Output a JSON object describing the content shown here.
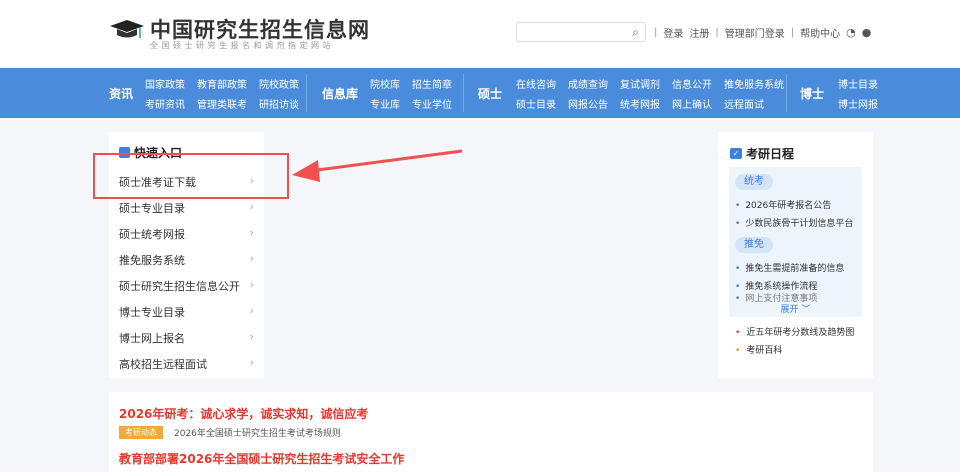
{
  "header": {
    "title": "中国研究生招生信息网",
    "subtitle": "全国硕士研究生报名和调剂指定网站",
    "search_placeholder": "",
    "links": [
      "登录",
      "注册",
      "管理部门登录",
      "帮助中心"
    ]
  },
  "nav": [
    {
      "head": "资讯",
      "items": [
        "国家政策",
        "考研资讯",
        "教育部政策",
        "管理类联考",
        "院校政策",
        "研招访谈"
      ]
    },
    {
      "head": "信息库",
      "items": [
        "院校库",
        "专业库",
        "招生简章",
        "专业学位"
      ]
    },
    {
      "head": "硕士",
      "items": [
        "在线咨询",
        "硕士目录",
        "成绩查询",
        "网报公告",
        "复试调剂",
        "统考网报",
        "信息公开",
        "网上确认",
        "推免服务系统",
        "远程面试"
      ]
    },
    {
      "head": "博士",
      "items": [
        "博士目录",
        "博士网报"
      ]
    }
  ],
  "quick": {
    "title": "快速入口",
    "items": [
      "硕士准考证下载",
      "硕士专业目录",
      "硕士统考网报",
      "推免服务系统",
      "硕士研究生招生信息公开",
      "博士专业目录",
      "博士网上报名",
      "高校招生远程面试"
    ]
  },
  "schedule": {
    "title": "考研日程",
    "groups": [
      {
        "tag": "统考",
        "items": [
          "2026年研考报名公告",
          "少数民族骨干计划信息平台"
        ]
      },
      {
        "tag": "推免",
        "items": [
          "推免生需提前准备的信息",
          "推免系统操作流程",
          "网上支付注意事项"
        ]
      }
    ],
    "expand": "展开",
    "extra": [
      "近五年研考分数线及趋势图",
      "考研百科"
    ]
  },
  "news": {
    "headline1": "2026年研考：诚心求学，诚实求知，诚信应考",
    "badge": "考研动态",
    "sub1": "2026年全国硕士研究生招生考试考场规则",
    "headline2": "教育部部署2026年全国硕士研究生招生考试安全工作"
  },
  "colors": {
    "nav": "#4a8bdb",
    "accent": "#3b82e0",
    "headline": "#e8372c",
    "annotation": "#f05050"
  }
}
